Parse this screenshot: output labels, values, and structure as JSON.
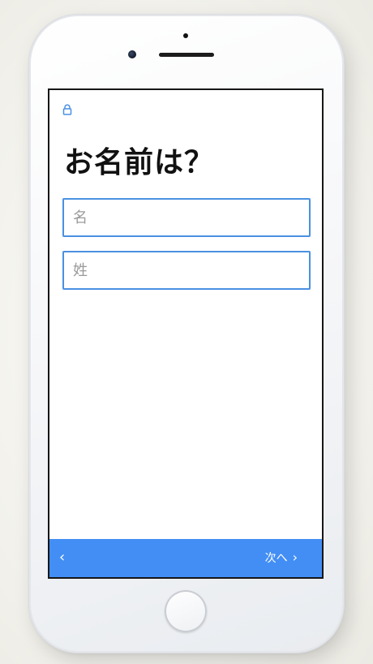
{
  "screen": {
    "title": "お名前は？",
    "fields": {
      "first_name_placeholder": "名",
      "last_name_placeholder": "姓"
    },
    "nav": {
      "back_label": "‹",
      "next_label": "次へ",
      "next_chevron": "›"
    },
    "icons": {
      "lock": "lock-icon",
      "back": "chevron-left-icon",
      "next": "chevron-right-icon"
    },
    "colors": {
      "accent": "#428ef5",
      "field_border": "#4a90e2",
      "title_text": "#111111"
    }
  }
}
